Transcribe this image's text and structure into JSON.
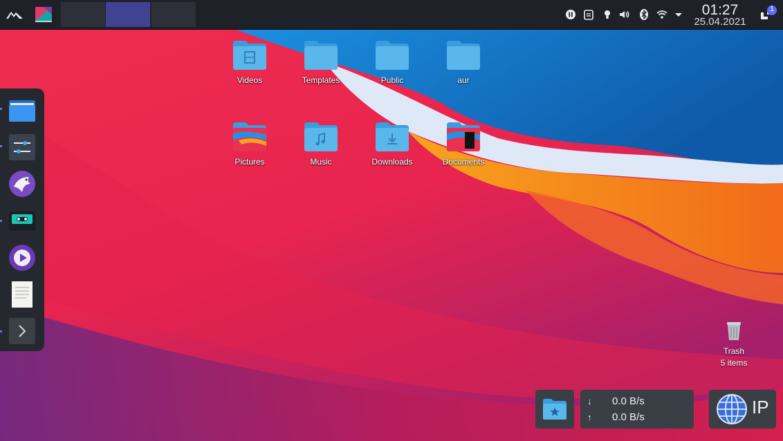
{
  "panel": {
    "pager_count": 3,
    "active_desktop": 2,
    "notification_count": "1",
    "clock": {
      "time": "01:27",
      "date": "25.04.2021"
    },
    "tray_icons": [
      "media-pause-icon",
      "clipboard-icon",
      "bulb-icon",
      "volume-icon",
      "bluetooth-icon",
      "wifi-icon",
      "tray-expand-icon"
    ]
  },
  "desktop": {
    "icons": [
      {
        "label": "Videos",
        "icon": "folder-videos-icon"
      },
      {
        "label": "Templates",
        "icon": "folder-templates-icon"
      },
      {
        "label": "Public",
        "icon": "folder-public-icon"
      },
      {
        "label": "aur",
        "icon": "folder-icon"
      },
      {
        "label": "Pictures",
        "icon": "folder-pictures-icon"
      },
      {
        "label": "Music",
        "icon": "folder-music-icon"
      },
      {
        "label": "Downloads",
        "icon": "folder-downloads-icon"
      },
      {
        "label": "Documents",
        "icon": "folder-documents-icon"
      }
    ],
    "trash": {
      "label": "Trash",
      "items": "5 items"
    }
  },
  "dock": {
    "items": [
      "file-manager-icon",
      "settings-sliders-icon",
      "eagle-app-icon",
      "cassette-player-icon",
      "media-player-icon",
      "text-document-icon",
      "terminal-icon"
    ]
  },
  "netspeed": {
    "down": "0.0 B/s",
    "up": "0.0 B/s",
    "down_arrow": "↓",
    "up_arrow": "↑"
  },
  "ip_widget": {
    "label": "IP"
  },
  "colors": {
    "panel_bg": "#1e2127",
    "pager_active": "#3f4391",
    "badge": "#5a6bff",
    "folder_blue": "#3daee9"
  }
}
